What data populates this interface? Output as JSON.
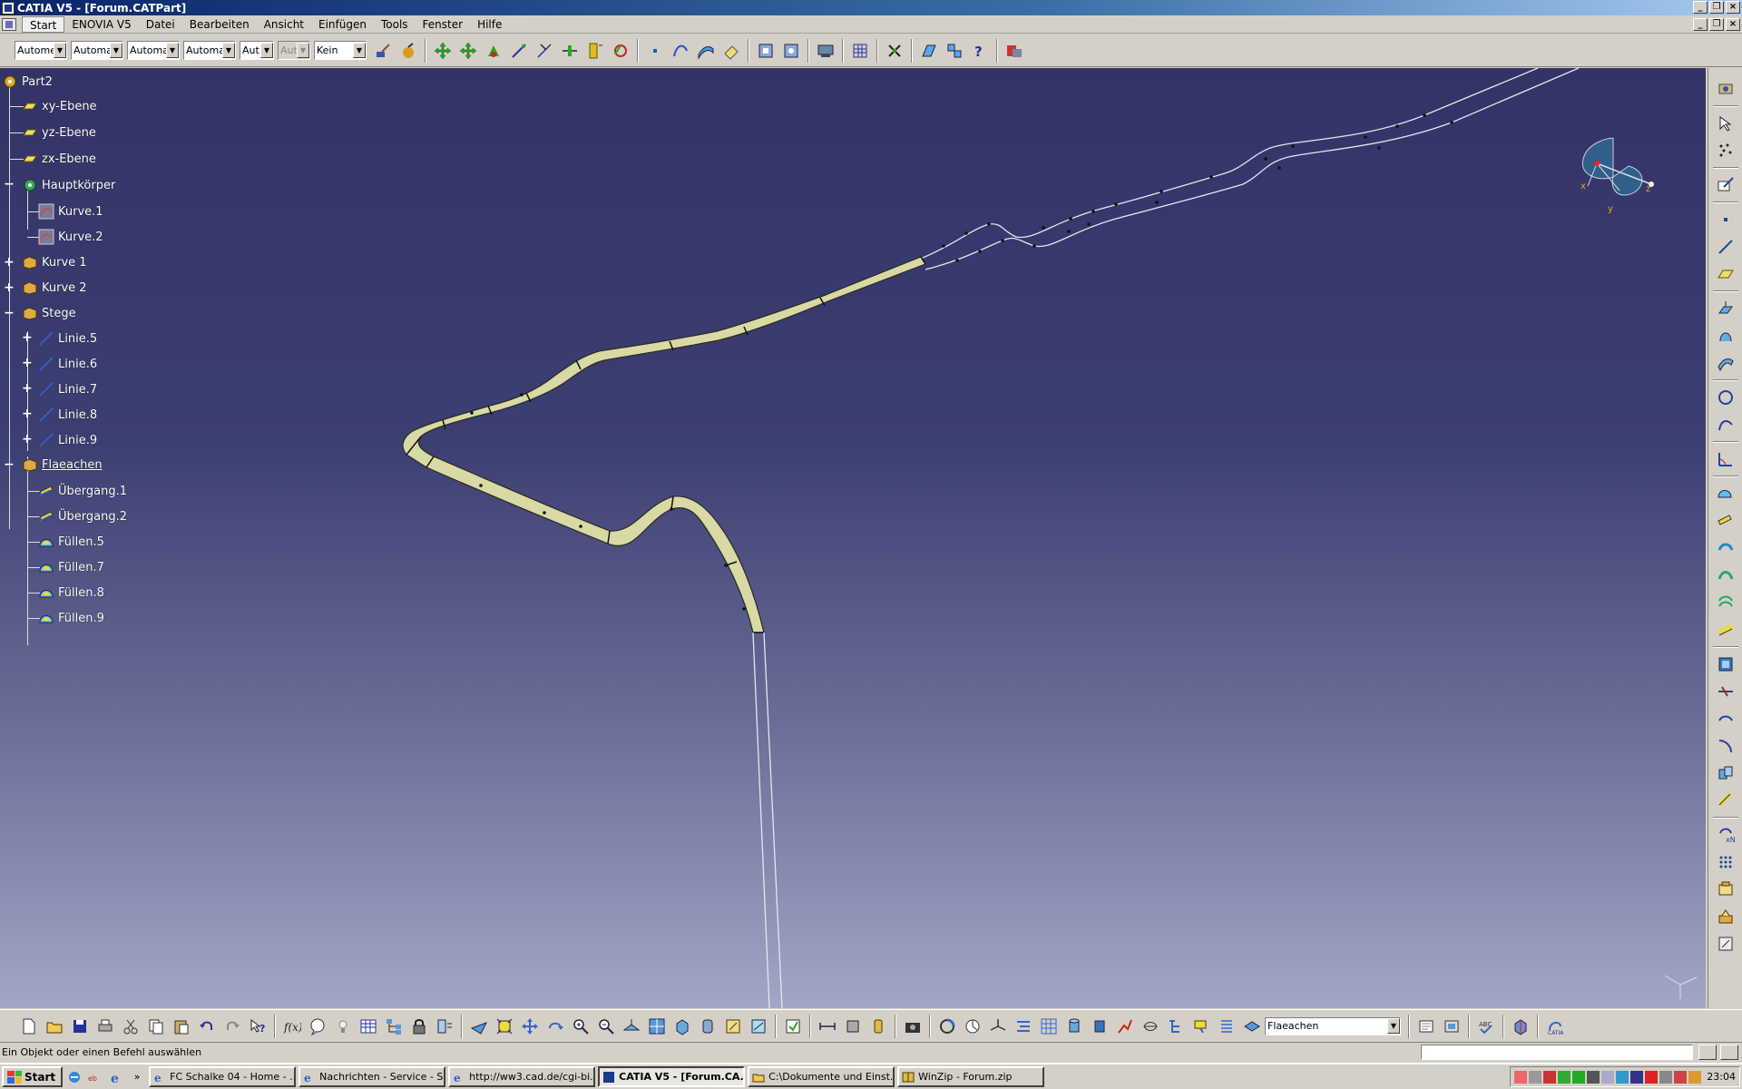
{
  "window": {
    "title": "CATIA V5 - [Forum.CATPart]",
    "minimize": "_",
    "restore": "❐",
    "close": "×"
  },
  "menu": {
    "items": [
      "Start",
      "ENOVIA V5",
      "Datei",
      "Bearbeiten",
      "Ansicht",
      "Einfügen",
      "Tools",
      "Fenster",
      "Hilfe"
    ]
  },
  "toolbar_top": {
    "combos": [
      "Autome",
      "Automa",
      "Automa",
      "Automa",
      "Aut",
      "Aut",
      "Kein"
    ]
  },
  "tree": {
    "root": "Part2",
    "nodes": [
      {
        "label": "xy-Ebene"
      },
      {
        "label": "yz-Ebene"
      },
      {
        "label": "zx-Ebene"
      },
      {
        "label": "Hauptkörper"
      },
      {
        "label": "Kurve.1"
      },
      {
        "label": "Kurve.2"
      },
      {
        "label": "Kurve 1"
      },
      {
        "label": "Kurve 2"
      },
      {
        "label": "Stege"
      },
      {
        "label": "Linie.5"
      },
      {
        "label": "Linie.6"
      },
      {
        "label": "Linie.7"
      },
      {
        "label": "Linie.8"
      },
      {
        "label": "Linie.9"
      },
      {
        "label": "Flaeachen"
      },
      {
        "label": "Übergang.1"
      },
      {
        "label": "Übergang.2"
      },
      {
        "label": "Füllen.5"
      },
      {
        "label": "Füllen.7"
      },
      {
        "label": "Füllen.8"
      },
      {
        "label": "Füllen.9"
      }
    ]
  },
  "compass": {
    "x": "x",
    "y": "y",
    "z": "z"
  },
  "toolbar_bottom": {
    "layer_combo": "Flaeachen"
  },
  "status": {
    "message": "Ein Objekt oder einen Befehl auswählen"
  },
  "taskbar": {
    "start": "Start",
    "tasks": [
      {
        "label": "FC Schalke 04 - Home - ..."
      },
      {
        "label": "Nachrichten - Service - S..."
      },
      {
        "label": "http://ww3.cad.de/cgi-bi..."
      },
      {
        "label": "CATIA V5 - [Forum.CA..."
      },
      {
        "label": "C:\\Dokumente und Einst..."
      },
      {
        "label": "WinZip - Forum.zip"
      }
    ],
    "clock": "23:04"
  },
  "colors": {
    "surface_fill": "#d8d9a4",
    "viewport_top": "#333366",
    "viewport_bottom": "#a3a6c6",
    "title_bar": "#0a246a"
  }
}
